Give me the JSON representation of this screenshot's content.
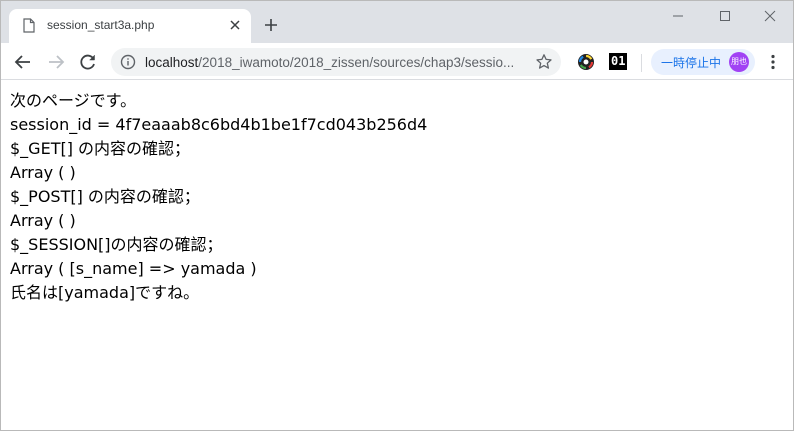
{
  "tab": {
    "title": "session_start3a.php"
  },
  "toolbar": {
    "url_host": "localhost",
    "url_path": "/2018_iwamoto/2018_zissen/sources/chap3/sessio...",
    "extension_text": "01",
    "pause_label": "一時停止中",
    "avatar_text": "朋也"
  },
  "content": {
    "lines": [
      "次のページです。",
      "session_id = 4f7eaaab8c6bd4b1be1f7cd043b256d4",
      "$_GET[] の内容の確認；",
      "Array ( )",
      "$_POST[] の内容の確認；",
      "Array ( )",
      "$_SESSION[]の内容の確認；",
      "Array ( [s_name] => yamada )",
      "氏名は[yamada]ですね。"
    ]
  },
  "colors": {
    "tabstrip_bg": "#dee1e6",
    "omnibox_bg": "#f1f3f4",
    "pause_pill_bg": "#e8f0fe",
    "pause_text": "#1a73e8",
    "avatar_bg": "#a142f4"
  }
}
